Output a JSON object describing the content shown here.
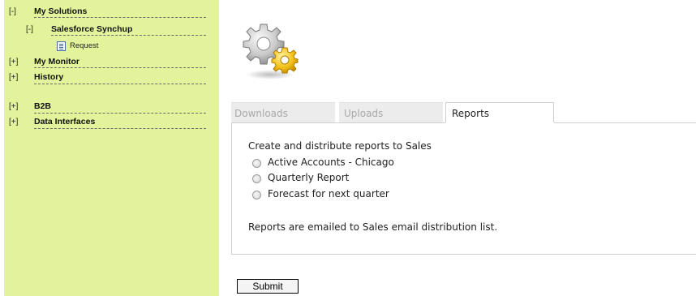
{
  "sidebar": {
    "items": [
      {
        "toggle": "[-]",
        "label": "My Solutions"
      },
      {
        "toggle": "[-]",
        "label": "Salesforce Synchup"
      },
      {
        "label": "Request",
        "icon": "document-icon"
      },
      {
        "toggle": "[+]",
        "label": "My Monitor"
      },
      {
        "toggle": "[+]",
        "label": "History"
      },
      {
        "toggle": "[+]",
        "label": "B2B"
      },
      {
        "toggle": "[+]",
        "label": "Data Interfaces"
      }
    ],
    "background": "#e3f39b"
  },
  "logo": {
    "icon": "gears-icon"
  },
  "tabs": [
    {
      "label": "Downloads",
      "active": false
    },
    {
      "label": "Uploads",
      "active": false
    },
    {
      "label": "Reports",
      "active": true
    }
  ],
  "reports": {
    "intro": "Create and distribute reports to Sales",
    "options": [
      {
        "label": "Active Accounts - Chicago",
        "selected": false
      },
      {
        "label": "Quarterly Report",
        "selected": false
      },
      {
        "label": "Forecast for next quarter",
        "selected": false
      }
    ],
    "note": "Reports are emailed to Sales email distribution list."
  },
  "submit_label": "Submit"
}
